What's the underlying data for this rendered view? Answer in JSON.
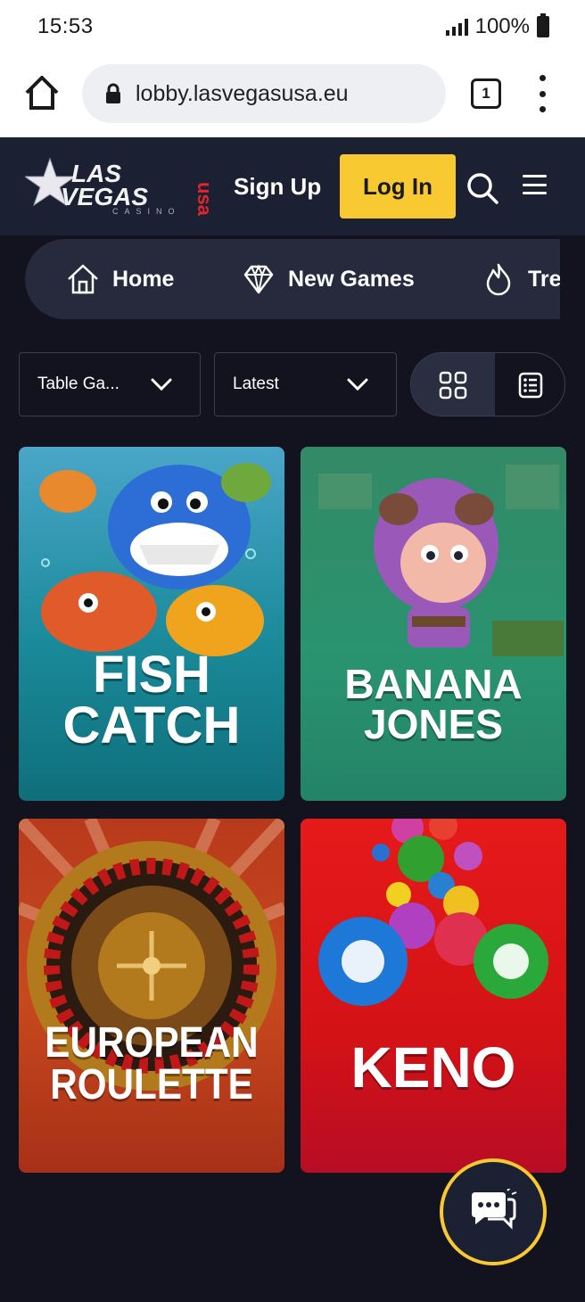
{
  "status_bar": {
    "time": "15:53",
    "battery": "100%"
  },
  "browser": {
    "url": "lobby.lasvegasusa.eu",
    "tab_count": "1"
  },
  "header": {
    "logo": {
      "line1": "LAS",
      "line2": "VEGAS",
      "badge": "usa",
      "sub": "CASINO"
    },
    "signup_label": "Sign Up",
    "login_label": "Log In"
  },
  "category_nav": {
    "items": [
      {
        "label": "Home",
        "icon": "house-icon"
      },
      {
        "label": "New Games",
        "icon": "diamond-icon"
      },
      {
        "label": "Tre",
        "icon": "flame-icon"
      }
    ]
  },
  "filters": {
    "category": {
      "value": "Table Ga..."
    },
    "sort": {
      "value": "Latest"
    },
    "view_mode": "grid"
  },
  "games": [
    {
      "title_lines": [
        "FISH",
        "CATCH"
      ]
    },
    {
      "title_lines": [
        "BANANA",
        "JONES"
      ]
    },
    {
      "title_lines": [
        "EUROPEAN",
        "ROULETTE"
      ]
    },
    {
      "title_lines": [
        "KENO"
      ]
    }
  ],
  "colors": {
    "page_bg": "#12131f",
    "header_bg": "#1c2033",
    "accent": "#f9c932",
    "nav_bg": "#262a3c"
  }
}
